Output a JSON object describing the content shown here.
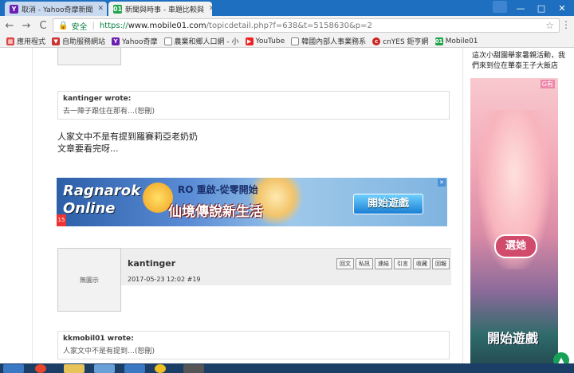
{
  "tabs": [
    {
      "title": "取消 - Yahoo奇摩新聞",
      "favicon": "Y",
      "favicon_color": "#6b1fb1",
      "active": false
    },
    {
      "title": "新聞與時事 - 車題比較與",
      "favicon": "01",
      "favicon_color": "#1fa34a",
      "active": true
    }
  ],
  "window": {
    "minimize": "—",
    "maximize": "□",
    "close": "✕"
  },
  "toolbar": {
    "back": "←",
    "forward": "→",
    "reload": "C",
    "secure_label": "安全",
    "url_scheme": "https://",
    "url_host": "www.mobile01.com",
    "url_path": "/topicdetail.php?f=638&t=5158630&p=2",
    "star": "☆",
    "menu": "⋮"
  },
  "bookmarks": [
    {
      "label": "應用程式",
      "icon": "apps-icon",
      "color": "#d44"
    },
    {
      "label": "自助服務網站",
      "icon": "shield-icon",
      "color": "#c33"
    },
    {
      "label": "Yahoo奇摩",
      "icon": "yahoo-icon",
      "color": "#6b1fb1"
    },
    {
      "label": "農業和鄉人口網 - 小",
      "icon": "page-icon",
      "color": "#888"
    },
    {
      "label": "YouTube",
      "icon": "youtube-icon",
      "color": "#e22"
    },
    {
      "label": "韓國內部人事業務系",
      "icon": "page-icon",
      "color": "#888"
    },
    {
      "label": "cnYES 鉅亨網",
      "icon": "cnyes-icon",
      "color": "#c22"
    },
    {
      "label": "Mobile01",
      "icon": "mobile01-icon",
      "color": "#1fa34a"
    }
  ],
  "quote1": {
    "author": "kantinger wrote:",
    "text": "去一陣子跟住在那有…(恕刪)"
  },
  "post_text": [
    "人家文中不是有提到羅賽莉亞老奶奶",
    "文章要看完呀..."
  ],
  "ad": {
    "logo": "Ragnarok Online",
    "age": "15",
    "subtitle": "RO 重啟-從零開始",
    "title": "仙境傳說新生活",
    "button": "開始遊戲"
  },
  "post2": {
    "avatar_text": "無圖示",
    "author": "kantinger",
    "meta": "2017-05-23 12:02  #19",
    "actions": [
      "回文",
      "私訊",
      "連結",
      "引言",
      "收藏",
      "回報"
    ]
  },
  "quote2": {
    "author": "kkmobil01 wrote:",
    "text": "人家文中不是有提到…(恕刪)"
  },
  "sidebar": {
    "text": "這次小甜園舉家暑親活動，我們來到位在華泰王子大飯店",
    "ad_brand": "G有",
    "cta1": "選她",
    "cta2": "開始遊戲"
  },
  "scroll_top": "▲"
}
